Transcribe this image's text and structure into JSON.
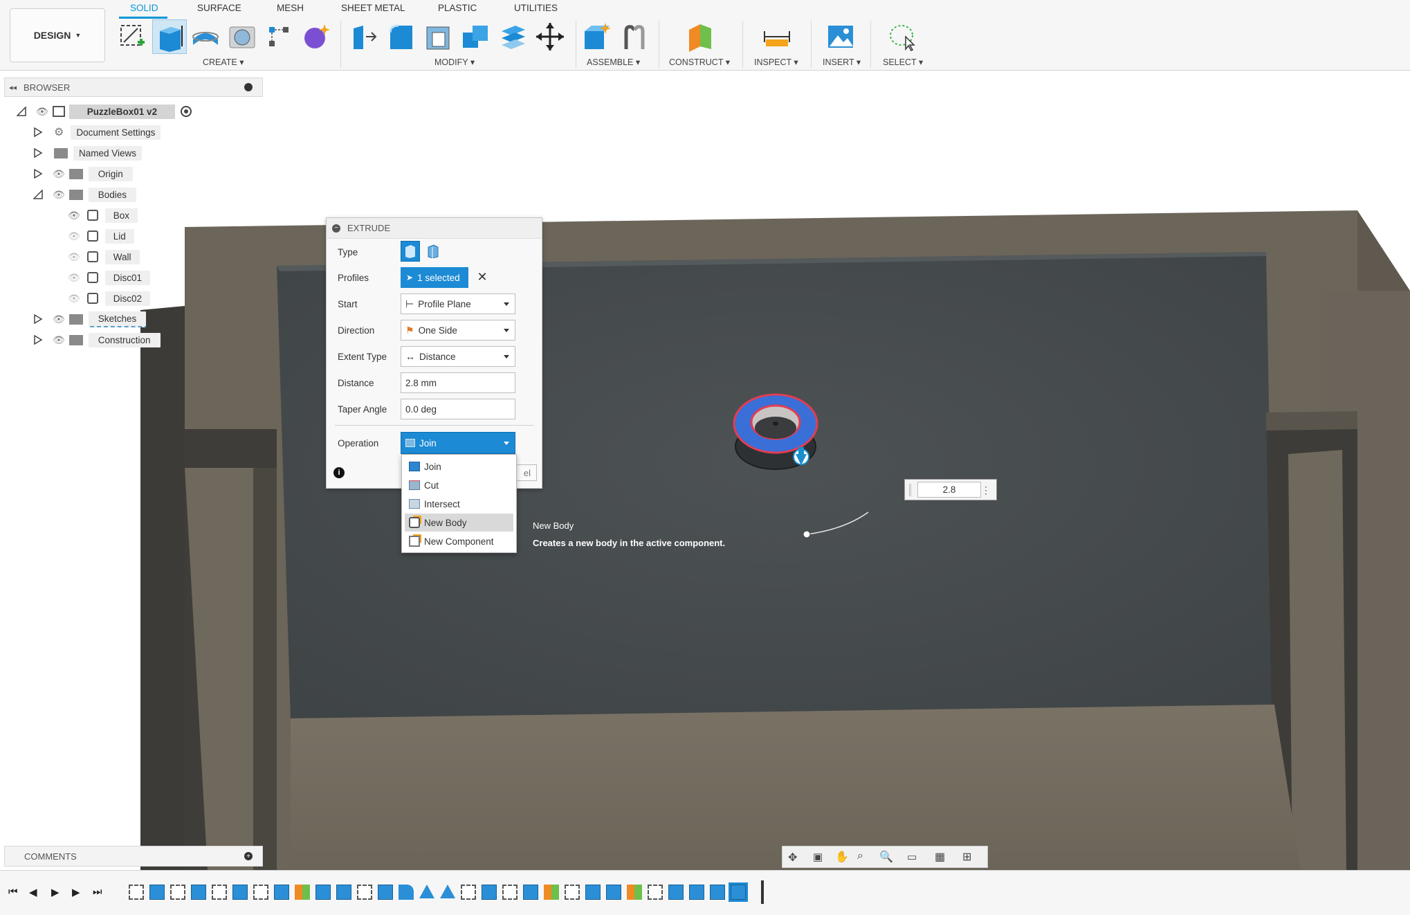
{
  "toolbar": {
    "design_label": "DESIGN",
    "tabs": [
      {
        "label": "SOLID"
      },
      {
        "label": "SURFACE"
      },
      {
        "label": "MESH"
      },
      {
        "label": "SHEET METAL"
      },
      {
        "label": "PLASTIC"
      },
      {
        "label": "UTILITIES"
      }
    ],
    "active_tab": "SOLID",
    "groups": {
      "create": "CREATE",
      "modify": "MODIFY",
      "assemble": "ASSEMBLE",
      "construct": "CONSTRUCT",
      "inspect": "INSPECT",
      "insert": "INSERT",
      "select": "SELECT"
    }
  },
  "browser": {
    "title": "BROWSER",
    "root": "PuzzleBox01 v2",
    "items": [
      {
        "label": "Document Settings",
        "icon": "gear-icon"
      },
      {
        "label": "Named Views",
        "icon": "folder-icon"
      },
      {
        "label": "Origin",
        "icon": "folder-icon"
      },
      {
        "label": "Bodies",
        "icon": "folder-icon"
      },
      {
        "label": "Sketches",
        "icon": "folder-icon"
      },
      {
        "label": "Construction",
        "icon": "folder-icon"
      }
    ],
    "bodies": [
      {
        "label": "Box"
      },
      {
        "label": "Lid"
      },
      {
        "label": "Wall"
      },
      {
        "label": "Disc01"
      },
      {
        "label": "Disc02"
      }
    ]
  },
  "extrude": {
    "title": "EXTRUDE",
    "labels": {
      "type": "Type",
      "profiles": "Profiles",
      "start": "Start",
      "direction": "Direction",
      "extent_type": "Extent Type",
      "distance": "Distance",
      "taper_angle": "Taper Angle",
      "operation": "Operation"
    },
    "profiles_value": "1 selected",
    "start_value": "Profile Plane",
    "direction_value": "One Side",
    "extent_value": "Distance",
    "distance_value": "2.8 mm",
    "taper_value": "0.0 deg",
    "operation_value": "Join",
    "cancel_partial": "el"
  },
  "operation_dropdown": {
    "options": [
      "Join",
      "Cut",
      "Intersect",
      "New Body",
      "New Component"
    ],
    "highlighted": "New Body"
  },
  "tooltip": {
    "title": "New Body",
    "description": "Creates a new body in the active component."
  },
  "dimension_input": "2.8",
  "comments": {
    "title": "COMMENTS"
  },
  "colors": {
    "accent": "#0696d7",
    "model_dark": "#4b5052",
    "model_brown": "#6e675c",
    "profile_blue": "#3b6fd6",
    "profile_red": "#e0394f"
  }
}
